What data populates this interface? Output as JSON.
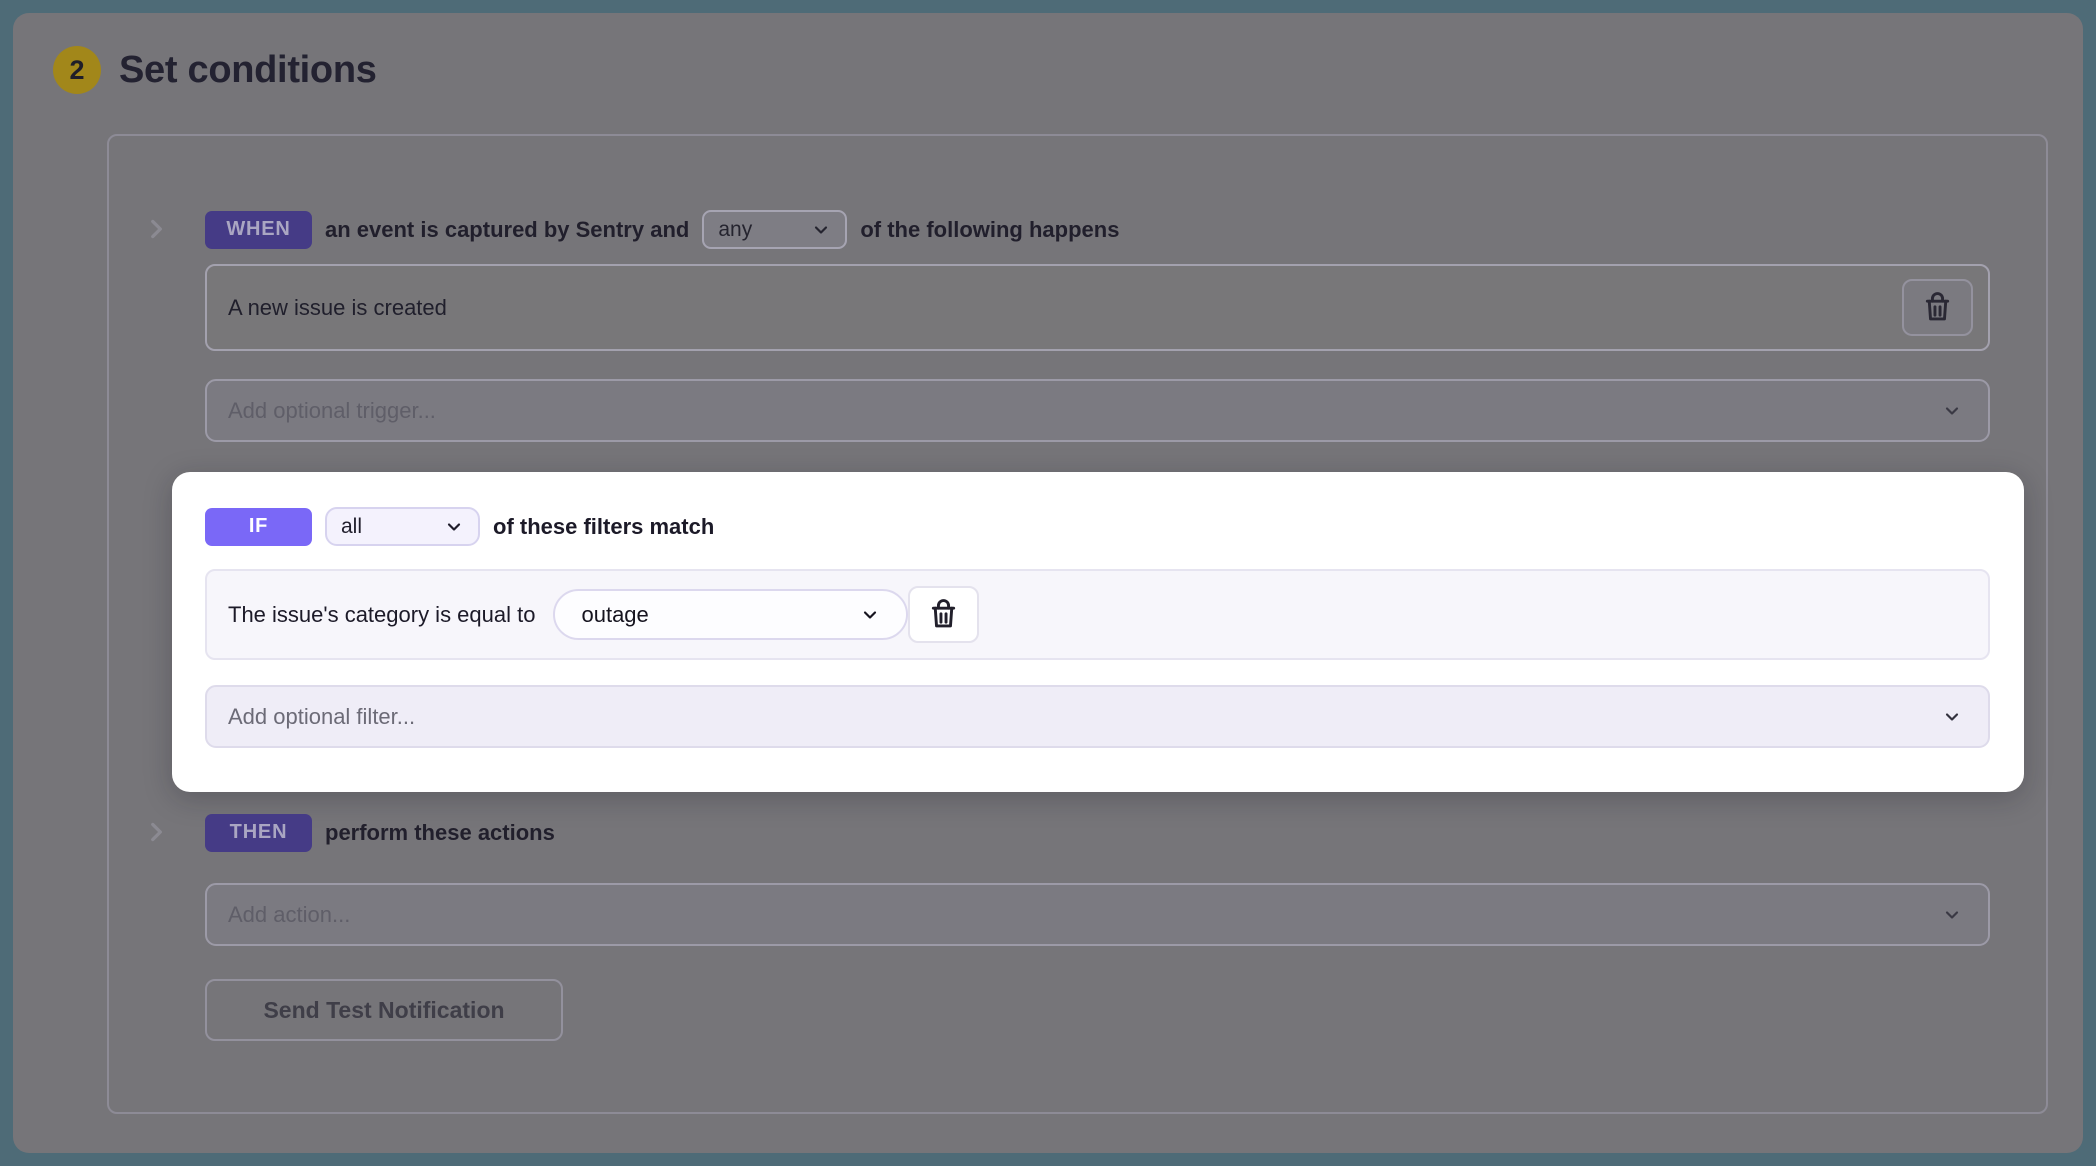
{
  "step": {
    "number": "2",
    "title": "Set conditions"
  },
  "when": {
    "badge": "WHEN",
    "text_before": "an event is captured by Sentry and",
    "match_select": "any",
    "text_after": "of the following happens",
    "rules": [
      {
        "label": "A new issue is created"
      }
    ],
    "add_placeholder": "Add optional trigger..."
  },
  "if": {
    "badge": "IF",
    "match_select": "all",
    "text_after": "of these filters match",
    "rules": [
      {
        "label": "The issue's category is equal to",
        "value_select": "outage"
      }
    ],
    "add_placeholder": "Add optional filter..."
  },
  "then": {
    "badge": "THEN",
    "text_after": "perform these actions",
    "add_placeholder": "Add action..."
  },
  "buttons": {
    "send_test": "Send Test Notification"
  },
  "colors": {
    "frame": "#4e6b77",
    "dim_backdrop": "#767579",
    "badge_dim": "#453b86",
    "badge_bright": "#7a68f7",
    "spotlight_bg": "#ffffff",
    "step_circle": "#a2871a"
  }
}
